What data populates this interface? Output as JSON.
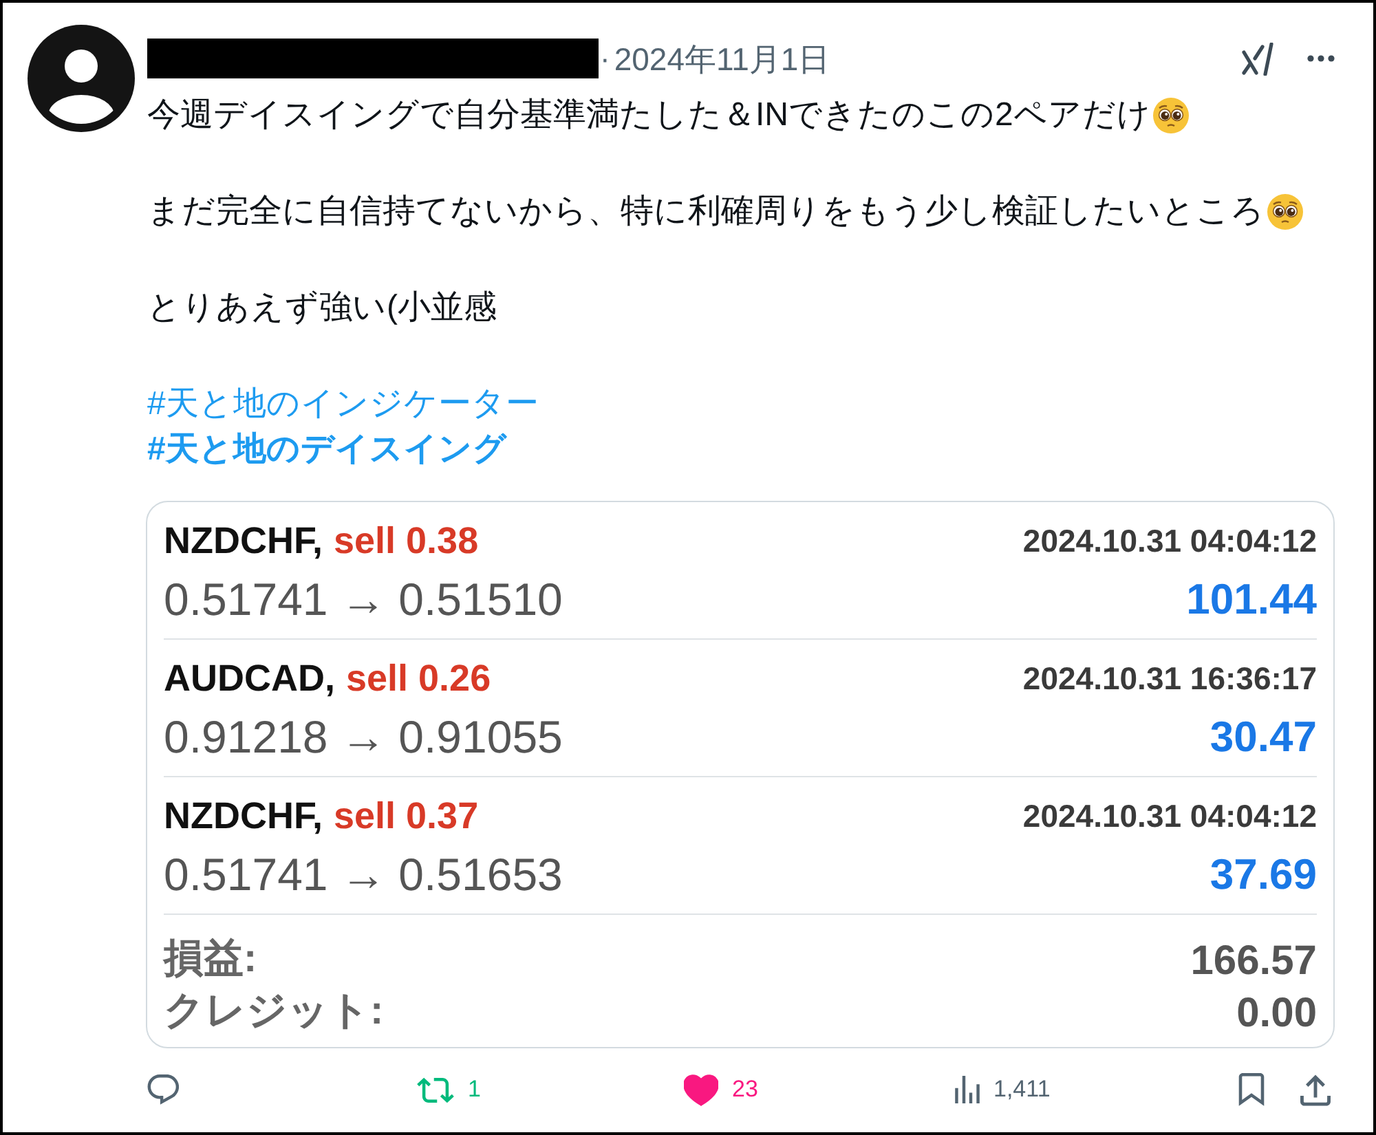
{
  "author": {
    "redacted": true
  },
  "separator": "·",
  "date": "2024年11月1日",
  "paragraphs": [
    {
      "text": "今週デイスイングで自分基準満たした＆INできたのこの2ペアだけ",
      "emoji": true
    },
    {
      "text": "まだ完全に自信持てないから、特に利確周りをもう少し検証したいところ",
      "emoji": true
    },
    {
      "text": "とりあえず強い(小並感",
      "emoji": false
    }
  ],
  "hashtags": [
    {
      "text": "#天と地のインジケーター",
      "bold": false
    },
    {
      "text": "#天と地のデイスイング",
      "bold": true
    }
  ],
  "trade_image": {
    "trades": [
      {
        "symbol": "NZDCHF,",
        "order": "sell 0.38",
        "time": "2024.10.31 04:04:12",
        "prices": "0.51741 → 0.51510",
        "profit": "101.44"
      },
      {
        "symbol": "AUDCAD,",
        "order": "sell 0.26",
        "time": "2024.10.31 16:36:17",
        "prices": "0.91218 → 0.91055",
        "profit": "30.47"
      },
      {
        "symbol": "NZDCHF,",
        "order": "sell 0.37",
        "time": "2024.10.31 04:04:12",
        "prices": "0.51741 → 0.51653",
        "profit": "37.69"
      }
    ],
    "summary": [
      {
        "label": "損益:",
        "value": "166.57"
      },
      {
        "label": "クレジット:",
        "value": "0.00"
      }
    ]
  },
  "actions": [
    {
      "kind": "reply"
    },
    {
      "kind": "repost",
      "count": "1",
      "active": true
    },
    {
      "kind": "like",
      "count": "23",
      "active": true
    },
    {
      "kind": "views",
      "count": "1,411"
    },
    {
      "kind": "bookmark",
      "active": false
    },
    {
      "kind": "share"
    }
  ]
}
